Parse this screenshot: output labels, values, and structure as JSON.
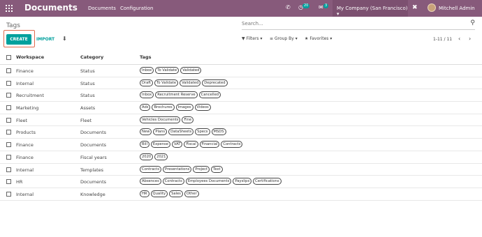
{
  "app": {
    "title": "Documents",
    "menu": [
      "Documents",
      "Configuration"
    ],
    "activity_count": "20",
    "chat_count": "3",
    "company": "My Company (San Francisco)",
    "user": "Mitchell Admin"
  },
  "control_panel": {
    "breadcrumb": "Tags",
    "search_placeholder": "Search...",
    "create_label": "CREATE",
    "import_label": "IMPORT",
    "filters_label": "Filters",
    "groupby_label": "Group By",
    "favorites_label": "Favorites",
    "pager": "1-11 / 11"
  },
  "table": {
    "headers": [
      "Workspace",
      "Category",
      "Tags"
    ],
    "rows": [
      {
        "workspace": "Finance",
        "category": "Status",
        "tags": [
          "Inbox",
          "To Validate",
          "Validated"
        ]
      },
      {
        "workspace": "Internal",
        "category": "Status",
        "tags": [
          "Draft",
          "To Validate",
          "Validated",
          "Deprecated"
        ]
      },
      {
        "workspace": "Recruitment",
        "category": "Status",
        "tags": [
          "Inbox",
          "Recruitment Reserve",
          "Cancelled"
        ]
      },
      {
        "workspace": "Marketing",
        "category": "Assets",
        "tags": [
          "Ads",
          "Brochures",
          "Images",
          "Videos"
        ]
      },
      {
        "workspace": "Fleet",
        "category": "Fleet",
        "tags": [
          "Vehicles Documents",
          "Fine"
        ]
      },
      {
        "workspace": "Products",
        "category": "Documents",
        "tags": [
          "New",
          "Plans",
          "DataSheets",
          "Specs",
          "MSDS"
        ]
      },
      {
        "workspace": "Finance",
        "category": "Documents",
        "tags": [
          "Bill",
          "Expense",
          "VAT",
          "Fiscal",
          "Financial",
          "Contracts"
        ]
      },
      {
        "workspace": "Finance",
        "category": "Fiscal years",
        "tags": [
          "2020",
          "2021"
        ]
      },
      {
        "workspace": "Internal",
        "category": "Templates",
        "tags": [
          "Contracts",
          "Presentations",
          "Project",
          "Text"
        ]
      },
      {
        "workspace": "HR",
        "category": "Documents",
        "tags": [
          "Absences",
          "Contracts",
          "Employees Documents",
          "Payslips",
          "Certifications"
        ]
      },
      {
        "workspace": "Internal",
        "category": "Knowledge",
        "tags": [
          "HR",
          "Quality",
          "Sales",
          "Other"
        ]
      }
    ]
  },
  "colors": {
    "navbar": "#875a7b",
    "accent": "#00a09d",
    "highlight": "#e06b4e"
  }
}
